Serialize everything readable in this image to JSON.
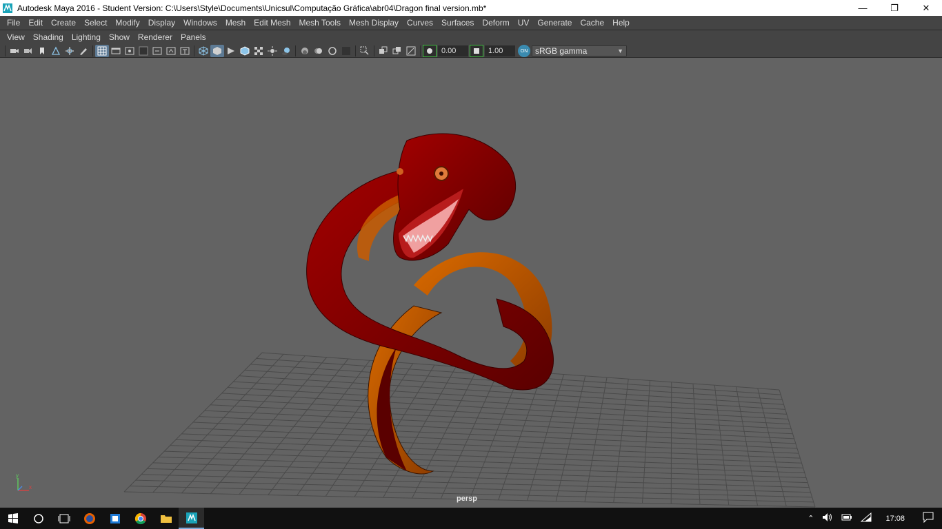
{
  "window": {
    "title": "Autodesk Maya 2016 - Student Version: C:\\Users\\Style\\Documents\\Unicsul\\Computação Gráfica\\abr04\\Dragon final version.mb*",
    "minimize_icon": "minimize-icon",
    "maximize_icon": "restore-icon",
    "close_icon": "close-icon"
  },
  "main_menu": [
    "File",
    "Edit",
    "Create",
    "Select",
    "Modify",
    "Display",
    "Windows",
    "Mesh",
    "Edit Mesh",
    "Mesh Tools",
    "Mesh Display",
    "Curves",
    "Surfaces",
    "Deform",
    "UV",
    "Generate",
    "Cache",
    "Help"
  ],
  "panel_menu": [
    "View",
    "Shading",
    "Lighting",
    "Show",
    "Renderer",
    "Panels"
  ],
  "toolbar": {
    "exposure_value": "0.00",
    "gamma_value": "1.00",
    "color_space": "sRGB gamma"
  },
  "viewport": {
    "camera_label": "persp",
    "axis_labels": {
      "x": "x",
      "y": "y",
      "z": "z"
    },
    "colors": {
      "background": "#636363",
      "grid": "#4a4a4a",
      "dragon_red": "#8b0000",
      "dragon_belly": "#c85a00"
    }
  },
  "taskbar": {
    "icons": [
      "windows-start-icon",
      "search-circle-icon",
      "task-view-icon",
      "firefox-icon",
      "app-icon",
      "chrome-icon",
      "file-explorer-icon",
      "maya-icon"
    ],
    "clock": "17:08"
  }
}
